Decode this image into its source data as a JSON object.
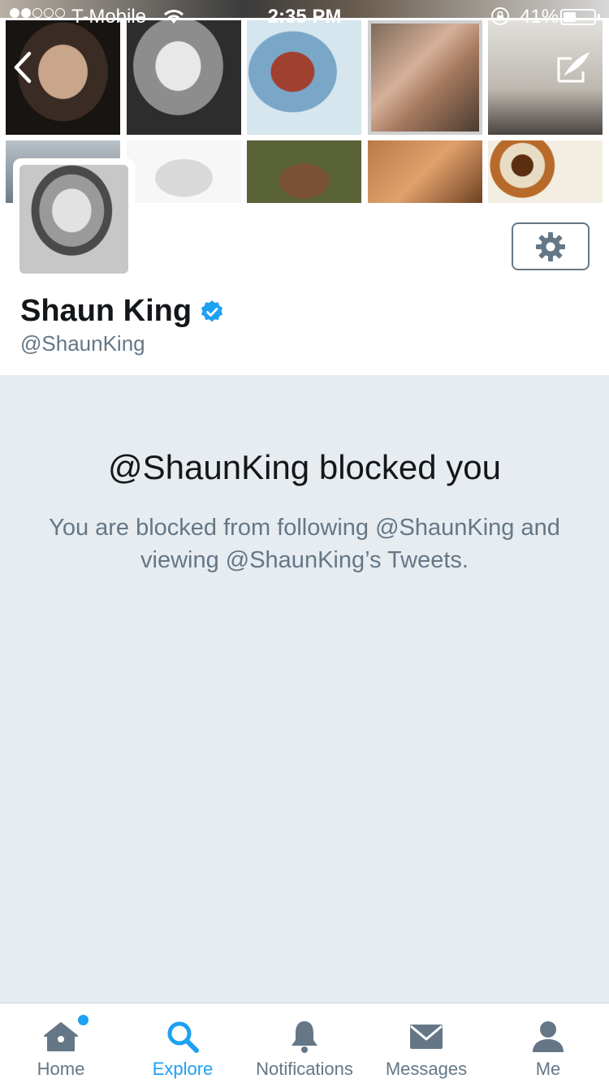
{
  "status_bar": {
    "carrier": "T-Mobile",
    "time": "2:35 PM",
    "battery_percent": "41%",
    "battery_level": 0.41,
    "signal_bars": 2
  },
  "profile": {
    "name": "Shaun King",
    "handle": "@ShaunKing",
    "verified": true
  },
  "blocked": {
    "title": "@ShaunKing blocked you",
    "body": "You are blocked from following @ShaunKing and viewing @ShaunKing’s Tweets."
  },
  "tabs": [
    {
      "label": "Home",
      "icon": "home-icon"
    },
    {
      "label": "Explore",
      "icon": "search-icon"
    },
    {
      "label": "Notifications",
      "icon": "bell-icon"
    },
    {
      "label": "Messages",
      "icon": "envelope-icon"
    },
    {
      "label": "Me",
      "icon": "person-icon"
    }
  ],
  "colors": {
    "accent": "#1da1f2",
    "muted": "#657786",
    "background": "#e6ecf0"
  }
}
